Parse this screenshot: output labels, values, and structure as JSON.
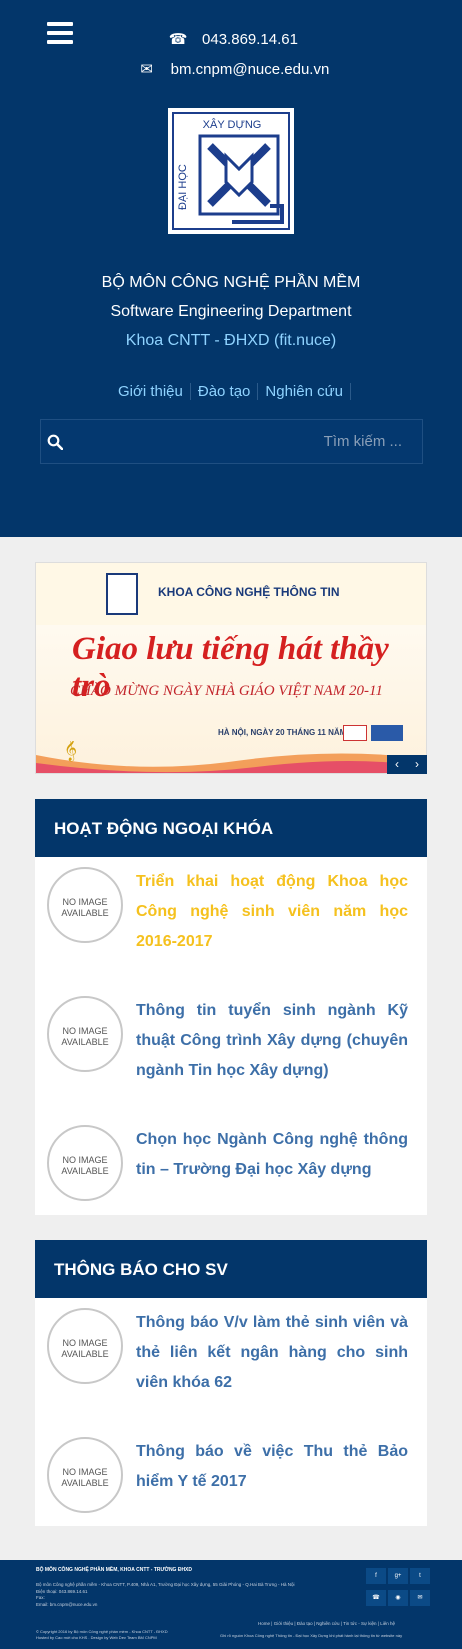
{
  "header": {
    "menu_icon": "hamburger-icon",
    "phone_icon": "phone-icon",
    "phone": "043.869.14.61",
    "email_icon": "envelope-icon",
    "email": "bm.cnpm@nuce.edu.vn",
    "logo_text_top": "XÂY DỰNG",
    "logo_text_side": "ĐẠI HỌC",
    "dept_vi": "BỘ MÔN CÔNG NGHỆ PHẦN MỀM",
    "dept_en": "Software Engineering Department",
    "faculty": "Khoa CNTT - ĐHXD (fit.nuce)",
    "nav": [
      "Giới thiệu",
      "Đào tạo",
      "Nghiên cứu"
    ],
    "search_icon": "search-icon",
    "search_placeholder": "Tìm kiếm ..."
  },
  "banner": {
    "khoa": "KHOA CÔNG NGHỆ THÔNG TIN",
    "title": "Giao lưu tiếng hát thầy trò",
    "subtitle": "CHÀO MỪNG NGÀY NHÀ GIÁO VIỆT NAM 20-11",
    "date": "HÀ NỘI, NGÀY 20 THÁNG 11 NĂM 2016",
    "prev_icon": "chevron-left-icon",
    "next_icon": "chevron-right-icon",
    "prev": "‹",
    "next": "›"
  },
  "panels": [
    {
      "title": "HOẠT ĐỘNG NGOẠI KHÓA",
      "items": [
        {
          "image": "NO IMAGE AVAILABLE",
          "title": "Triển khai hoạt động Khoa học Công nghệ sinh viên năm học 2016-2017"
        },
        {
          "image": "NO IMAGE AVAILABLE",
          "title": "Thông tin tuyển sinh ngành Kỹ thuật Công trình Xây dựng (chuyên ngành Tin học Xây dựng)"
        },
        {
          "image": "NO IMAGE AVAILABLE",
          "title": "Chọn học Ngành Công nghệ thông tin – Trường Đại học Xây dựng"
        }
      ]
    },
    {
      "title": "THÔNG BÁO CHO SV",
      "items": [
        {
          "image": "NO IMAGE AVAILABLE",
          "title": "Thông báo V/v làm thẻ sinh viên và thẻ liên kết ngân hàng cho sinh viên khóa 62"
        },
        {
          "image": "NO IMAGE AVAILABLE",
          "title": "Thông báo về việc Thu thẻ Bảo hiểm Y tế 2017"
        }
      ]
    }
  ],
  "footer": {
    "title": "BỘ MÔN CÔNG NGHỆ PHẦN MỀM, KHOA CNTT - TRƯỜNG ĐHXD",
    "address": "Bộ môn Công nghệ phần mềm - Khoa CNTT, P.409, Nhà A1, Trường Đại học Xây dựng, 55 Giải Phóng - Q.Hai Bà Trưng - Hà Nội",
    "phone": "Điện thoại: 043.869.14.61",
    "fax": "Fax:",
    "email": "Email: bm.cnpm@nuce.edu.vn",
    "copyright": "© Copyright 2016 by Bộ môn Công nghệ phần mềm - Khoa CNTT - ĐHXD",
    "hosted": "Hosted by Cao mới cho KHS . Design by Web Dev Team BM CNPM",
    "nav": [
      "Home",
      "Giới thiệu",
      "Đào tạo",
      "Nghiên cứu",
      "Tin tức - Sự kiện",
      "Liên hệ"
    ],
    "notice": "Ghi rõ nguồn Khoa Công nghệ Thông tin - Đại học Xây Dựng khi phát hành lại thông tin từ website này",
    "socials": [
      "facebook-icon",
      "google-plus-icon",
      "twitter-icon",
      "phone-icon",
      "rss-icon",
      "mail-icon"
    ],
    "social_glyphs": [
      "f",
      "g+",
      "t",
      "☎",
      "◉",
      "✉"
    ]
  }
}
